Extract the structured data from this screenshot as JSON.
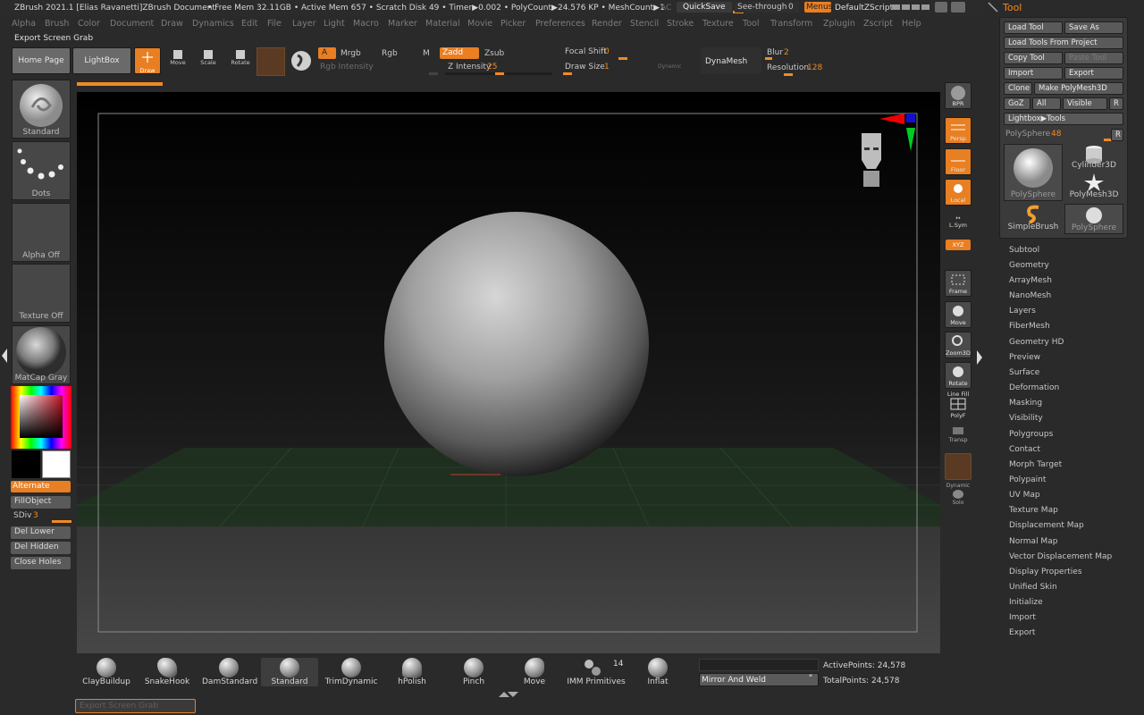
{
  "title": "ZBrush 2021.1 [Elias Ravanetti]ZBrush Document",
  "stats": "• Free Mem 32.11GB • Active Mem 657 • Scratch Disk 49 •  Timer▶0.002 • PolyCount▶24.576 KP  • MeshCount▶1",
  "menu": [
    "Alpha",
    "Brush",
    "Color",
    "Document",
    "Draw",
    "Dynamics",
    "Edit",
    "File",
    "Layer",
    "Light",
    "Macro",
    "Marker",
    "Material",
    "Movie",
    "Picker",
    "Preferences",
    "Render",
    "Stencil",
    "Stroke",
    "Texture",
    "Tool",
    "Transform",
    "Zplugin",
    "Zscript",
    "Help"
  ],
  "topright": {
    "ac": "AC",
    "quicksave": "QuickSave",
    "see_through": "See-through",
    "see_through_val": "0",
    "menus": "Menus",
    "defaultzscript": "DefaultZScript"
  },
  "shelf_label": "Export Screen Grab",
  "toolbar": {
    "home": "Home Page",
    "lightbox": "LightBox",
    "draw": "Draw",
    "move": "Move",
    "scale": "Scale",
    "rotate": "Rotate",
    "a": "A",
    "mrgb": "Mrgb",
    "rgb": "Rgb",
    "m": "M",
    "rgb_intensity": "Rgb Intensity",
    "zadd": "Zadd",
    "zsub": "Zsub",
    "z_intensity": "Z Intensity",
    "z_intensity_val": "25",
    "focal_shift": "Focal Shift",
    "focal_shift_val": "0",
    "draw_size": "Draw Size",
    "draw_size_val": "1",
    "dynamic": "Dynamic",
    "dynamesh": "DynaMesh",
    "blur": "Blur",
    "blur_val": "2",
    "resolution": "Resolution",
    "resolution_val": "128"
  },
  "left": {
    "brush": "Standard",
    "stroke": "Dots",
    "alpha": "Alpha Off",
    "texture": "Texture Off",
    "material": "MatCap Gray",
    "alternate": "Alternate",
    "fillobject": "FillObject",
    "sdiv": "SDiv",
    "sdiv_val": "3",
    "del_lower": "Del Lower",
    "del_hidden": "Del Hidden",
    "close_holes": "Close Holes"
  },
  "right_tools": {
    "bpr": "BPR",
    "persp": "Persp",
    "floor": "Floor",
    "local": "Local",
    "lsym": "L.Sym",
    "xyz": "XYZ",
    "frame": "Frame",
    "move": "Move",
    "zoom3d": "Zoom3D",
    "rotate": "Rotate",
    "line_fill": "Line Fill",
    "polyf": "PolyF",
    "transp": "Transp",
    "dynamic": "Dynamic",
    "solo": "Solo"
  },
  "tool_palette": {
    "header": "Tool",
    "load_tool": "Load Tool",
    "save_as": "Save As",
    "load_from_project": "Load Tools From Project",
    "copy_tool": "Copy Tool",
    "paste_tool": "Paste Tool",
    "import": "Import",
    "export": "Export",
    "clone": "Clone",
    "make_polymesh": "Make PolyMesh3D",
    "goz": "GoZ",
    "all": "All",
    "visible": "Visible",
    "r": "R",
    "lightbox_tools": "Lightbox▶Tools",
    "current": "PolySphere",
    "current_val": "48",
    "tools": [
      "PolySphere",
      "Cylinder3D",
      "PolyMesh3D",
      "SimpleBrush",
      "PolySphere"
    ]
  },
  "subpalettes": [
    "Subtool",
    "Geometry",
    "ArrayMesh",
    "NanoMesh",
    "Layers",
    "FiberMesh",
    "Geometry HD",
    "Preview",
    "Surface",
    "Deformation",
    "Masking",
    "Visibility",
    "Polygroups",
    "Contact",
    "Morph Target",
    "Polypaint",
    "UV Map",
    "Texture Map",
    "Displacement Map",
    "Normal Map",
    "Vector Displacement Map",
    "Display Properties",
    "Unified Skin",
    "Initialize",
    "Import",
    "Export"
  ],
  "bottom_brushes": [
    "ClayBuildup",
    "SnakeHook",
    "DamStandard",
    "Standard",
    "TrimDynamic",
    "hPolish",
    "Pinch",
    "Move",
    "IMM Primitives",
    "Inflat"
  ],
  "imm_count": "14",
  "mirror_weld": "Mirror And Weld",
  "active_points": "ActivePoints: 24,578",
  "total_points": "TotalPoints: 24,578",
  "bottom_field": "Export Screen Grab",
  "colors": {
    "accent": "#e87f22",
    "bg": "#2a2a2a",
    "viewport": "#000000"
  }
}
